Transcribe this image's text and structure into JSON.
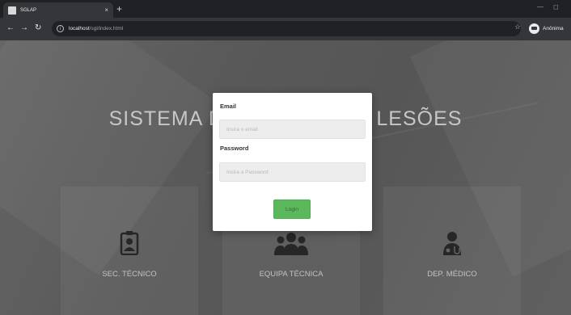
{
  "browser": {
    "tab_title": "SGLAP",
    "tab_close": "×",
    "new_tab": "+",
    "win_minimize": "—",
    "win_restore": "◻",
    "url_host": "localhost",
    "url_path": "/sgl/index.html",
    "profile_name": "Anônima",
    "icons": [
      "back-icon",
      "forward-icon",
      "reload-icon",
      "info-icon",
      "star-icon",
      "profile-icon"
    ]
  },
  "hero": {
    "title": "SISTEMA DE GESTÃO DE LESÕES"
  },
  "cards": [
    {
      "label": "SEC. TÉCNICO",
      "icon": "id-badge-icon"
    },
    {
      "label": "EQUIPA TÉCNICA",
      "icon": "users-group-icon"
    },
    {
      "label": "DEP. MÉDICO",
      "icon": "doctor-icon"
    }
  ],
  "login": {
    "email_label": "Email",
    "email_placeholder": "Insira o email",
    "password_label": "Password",
    "password_placeholder": "Insira a Password",
    "button_label": "Login",
    "button_color": "#5cb85c"
  },
  "colors": {
    "chrome_dark": "#202124",
    "chrome_toolbar": "#35363a",
    "page_overlay": "#5f5f5f",
    "icon_color": "#2a2a2a"
  }
}
